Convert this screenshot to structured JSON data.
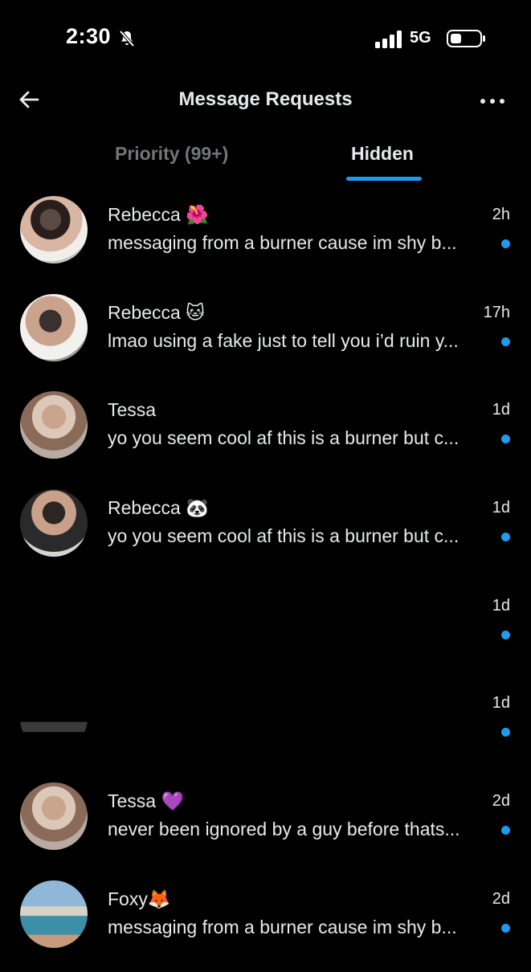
{
  "status_bar": {
    "time": "2:30",
    "network": "5G"
  },
  "header": {
    "title": "Message Requests"
  },
  "tabs": [
    {
      "label": "Priority (99+)",
      "active": false
    },
    {
      "label": "Hidden",
      "active": true
    }
  ],
  "colors": {
    "accent": "#1d9bf0",
    "background": "#000000",
    "text_primary": "#e7e9ea",
    "text_secondary": "#71767b"
  },
  "messages": [
    {
      "name": "Rebecca 🌺",
      "time": "2h",
      "preview": "messaging from a burner cause im shy b...",
      "unread": true
    },
    {
      "name": "Rebecca 🐱",
      "time": "17h",
      "preview": "lmao using a fake just to tell you i’d ruin y...",
      "unread": true
    },
    {
      "name": "Tessa",
      "time": "1d",
      "preview": "yo you seem cool af this is a burner but c...",
      "unread": true
    },
    {
      "name": "Rebecca 🐼",
      "time": "1d",
      "preview": "yo you seem cool af this is a burner but c...",
      "unread": true
    },
    {
      "name": "",
      "time": "1d",
      "preview": "",
      "unread": true
    },
    {
      "name": "",
      "time": "1d",
      "preview": "",
      "unread": true
    },
    {
      "name": "Tessa 💜",
      "time": "2d",
      "preview": "never been ignored by a guy before thats...",
      "unread": true
    },
    {
      "name": "Foxy🦊",
      "time": "2d",
      "preview": "messaging from a burner cause im shy b...",
      "unread": true
    }
  ]
}
